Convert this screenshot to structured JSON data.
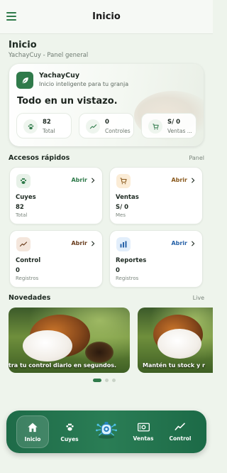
{
  "appbar": {
    "title": "Inicio"
  },
  "page": {
    "title": "Inicio",
    "subtitle": "YachayCuy - Panel general"
  },
  "hero": {
    "brand": "YachayCuy",
    "tagline": "Inicio inteligente para tu granja",
    "headline": "Todo en un vistazo.",
    "stats": [
      {
        "value": "82",
        "label": "Total",
        "icon": "paw-icon"
      },
      {
        "value": "0",
        "label": "Controles",
        "icon": "trend-icon"
      },
      {
        "value": "S/ 0",
        "label": "Ventas ...",
        "icon": "cart-icon"
      }
    ]
  },
  "quick_access": {
    "title": "Accesos rápidos",
    "right_label": "Panel",
    "cards": [
      {
        "name": "Cuyes",
        "value": "82",
        "caption": "Total",
        "open_label": "Abrir",
        "icon": "paw-icon",
        "accent": "#2f7a4a",
        "icon_bg": "#e7f1e8"
      },
      {
        "name": "Ventas",
        "value": "S/ 0",
        "caption": "Mes",
        "open_label": "Abrir",
        "icon": "cart-icon",
        "accent": "#8a5a1e",
        "icon_bg": "#fbecd6"
      },
      {
        "name": "Control",
        "value": "0",
        "caption": "Registros",
        "open_label": "Abrir",
        "icon": "trend-icon",
        "accent": "#6a3e1e",
        "icon_bg": "#f4e6dc"
      },
      {
        "name": "Reportes",
        "value": "0",
        "caption": "Registros",
        "open_label": "Abrir",
        "icon": "bar-chart-icon",
        "accent": "#2762a8",
        "icon_bg": "#e2eefb"
      }
    ]
  },
  "news": {
    "title": "Novedades",
    "right_label": "Live",
    "slides": [
      {
        "caption": "tra tu control diario en segundos."
      },
      {
        "caption": "Mantén tu stock y r"
      }
    ],
    "active_index": 0,
    "dot_count": 3
  },
  "bottom_nav": {
    "items": [
      {
        "label": "Inicio",
        "icon": "home-icon",
        "active": true
      },
      {
        "label": "Cuyes",
        "icon": "paw-icon",
        "active": false
      },
      {
        "label": "",
        "icon": "robot-assistant-icon",
        "active": false
      },
      {
        "label": "Ventas",
        "icon": "cash-icon",
        "active": false
      },
      {
        "label": "Control",
        "icon": "trend-icon",
        "active": false
      }
    ]
  }
}
